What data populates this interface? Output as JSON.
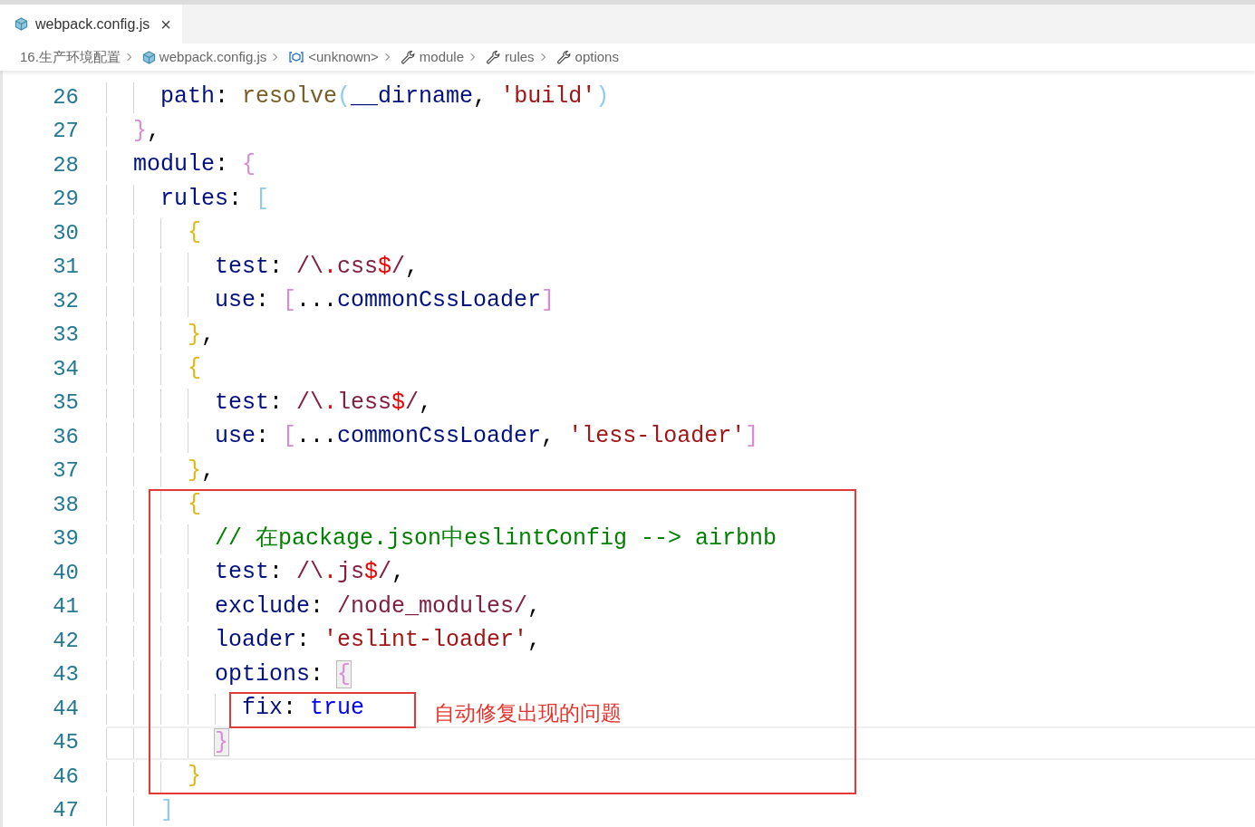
{
  "tab": {
    "label": "webpack.config.js",
    "close": "×",
    "selected": true
  },
  "breadcrumbs": [
    {
      "label": "16.生产环境配置",
      "kind": "folder"
    },
    {
      "label": "webpack.config.js",
      "kind": "file"
    },
    {
      "label": "<unknown>",
      "kind": "variable"
    },
    {
      "label": "module",
      "kind": "property"
    },
    {
      "label": "rules",
      "kind": "property"
    },
    {
      "label": "options",
      "kind": "property"
    }
  ],
  "lines": [
    {
      "children": [
        {
          "number": "26",
          "current": false,
          "tokens": [
            {
              "kind": "key",
              "text": "path"
            },
            {
              "kind": "punct",
              "text": ": "
            },
            {
              "kind": "func",
              "text": "resolve"
            },
            {
              "kind": "bracket",
              "text": "(",
              "color": "#8fcbef",
              "matched": false
            },
            {
              "kind": "key",
              "text": "__dirname"
            },
            {
              "kind": "punct",
              "text": ", "
            },
            {
              "kind": "string",
              "text": "'build'"
            },
            {
              "kind": "bracket",
              "text": ")",
              "color": "#8fcbef",
              "matched": false
            }
          ]
        }
      ]
    },
    {
      "number": "27",
      "current": false,
      "tokens": [
        {
          "kind": "bracket",
          "text": "}",
          "color": "#d88bd6",
          "matched": false
        },
        {
          "kind": "punct",
          "text": ","
        }
      ]
    },
    {
      "number": "28",
      "current": false,
      "tokens": [
        {
          "kind": "key",
          "text": "module"
        },
        {
          "kind": "punct",
          "text": ": "
        },
        {
          "kind": "bracket",
          "text": "{",
          "color": "#d88bd6",
          "matched": false
        }
      ],
      "children": [
        {
          "number": "29",
          "current": false,
          "tokens": [
            {
              "kind": "key",
              "text": "rules"
            },
            {
              "kind": "punct",
              "text": ": "
            },
            {
              "kind": "bracket",
              "text": "[",
              "color": "#8fcbef",
              "matched": false
            }
          ],
          "children": [
            {
              "number": "30",
              "current": false,
              "tokens": [
                {
                  "kind": "bracket",
                  "text": "{",
                  "color": "#e2b714",
                  "matched": false
                }
              ],
              "children": [
                {
                  "number": "31",
                  "current": false,
                  "tokens": [
                    {
                      "kind": "key",
                      "text": "test"
                    },
                    {
                      "kind": "punct",
                      "text": ": "
                    },
                    {
                      "kind": "regex",
                      "text": "/\\"
                    },
                    {
                      "kind": "regexop",
                      "text": "."
                    },
                    {
                      "kind": "regex",
                      "text": "css"
                    },
                    {
                      "kind": "regexop",
                      "text": "$"
                    },
                    {
                      "kind": "regex",
                      "text": "/"
                    },
                    {
                      "kind": "punct",
                      "text": ","
                    }
                  ]
                },
                {
                  "number": "32",
                  "current": false,
                  "tokens": [
                    {
                      "kind": "key",
                      "text": "use"
                    },
                    {
                      "kind": "punct",
                      "text": ": "
                    },
                    {
                      "kind": "bracket",
                      "text": "[",
                      "color": "#d88bd6",
                      "matched": false
                    },
                    {
                      "kind": "punct",
                      "text": "..."
                    },
                    {
                      "kind": "key",
                      "text": "commonCssLoader"
                    },
                    {
                      "kind": "bracket",
                      "text": "]",
                      "color": "#d88bd6",
                      "matched": false
                    }
                  ]
                }
              ]
            },
            {
              "number": "33",
              "current": false,
              "tokens": [
                {
                  "kind": "bracket",
                  "text": "}",
                  "color": "#e2b714",
                  "matched": false
                },
                {
                  "kind": "punct",
                  "text": ","
                }
              ]
            },
            {
              "number": "34",
              "current": false,
              "tokens": [
                {
                  "kind": "bracket",
                  "text": "{",
                  "color": "#e2b714",
                  "matched": false
                }
              ],
              "children": [
                {
                  "number": "35",
                  "current": false,
                  "tokens": [
                    {
                      "kind": "key",
                      "text": "test"
                    },
                    {
                      "kind": "punct",
                      "text": ": "
                    },
                    {
                      "kind": "regex",
                      "text": "/\\"
                    },
                    {
                      "kind": "regexop",
                      "text": "."
                    },
                    {
                      "kind": "regex",
                      "text": "less"
                    },
                    {
                      "kind": "regexop",
                      "text": "$"
                    },
                    {
                      "kind": "regex",
                      "text": "/"
                    },
                    {
                      "kind": "punct",
                      "text": ","
                    }
                  ]
                },
                {
                  "number": "36",
                  "current": false,
                  "tokens": [
                    {
                      "kind": "key",
                      "text": "use"
                    },
                    {
                      "kind": "punct",
                      "text": ": "
                    },
                    {
                      "kind": "bracket",
                      "text": "[",
                      "color": "#d88bd6",
                      "matched": false
                    },
                    {
                      "kind": "punct",
                      "text": "..."
                    },
                    {
                      "kind": "key",
                      "text": "commonCssLoader"
                    },
                    {
                      "kind": "punct",
                      "text": ", "
                    },
                    {
                      "kind": "string",
                      "text": "'less-loader'"
                    },
                    {
                      "kind": "bracket",
                      "text": "]",
                      "color": "#d88bd6",
                      "matched": false
                    }
                  ]
                }
              ]
            },
            {
              "number": "37",
              "current": false,
              "tokens": [
                {
                  "kind": "bracket",
                  "text": "}",
                  "color": "#e2b714",
                  "matched": false
                },
                {
                  "kind": "punct",
                  "text": ","
                }
              ]
            },
            {
              "number": "38",
              "current": false,
              "tokens": [
                {
                  "kind": "bracket",
                  "text": "{",
                  "color": "#e2b714",
                  "matched": false
                }
              ],
              "children": [
                {
                  "number": "39",
                  "current": false,
                  "tokens": [
                    {
                      "kind": "comment",
                      "text": "// 在package.json中eslintConfig --> airbnb"
                    }
                  ]
                },
                {
                  "number": "40",
                  "current": false,
                  "tokens": [
                    {
                      "kind": "key",
                      "text": "test"
                    },
                    {
                      "kind": "punct",
                      "text": ": "
                    },
                    {
                      "kind": "regex",
                      "text": "/\\"
                    },
                    {
                      "kind": "regexop",
                      "text": "."
                    },
                    {
                      "kind": "regex",
                      "text": "js"
                    },
                    {
                      "kind": "regexop",
                      "text": "$"
                    },
                    {
                      "kind": "regex",
                      "text": "/"
                    },
                    {
                      "kind": "punct",
                      "text": ","
                    }
                  ]
                },
                {
                  "number": "41",
                  "current": false,
                  "tokens": [
                    {
                      "kind": "key",
                      "text": "exclude"
                    },
                    {
                      "kind": "punct",
                      "text": ": "
                    },
                    {
                      "kind": "regex",
                      "text": "/node_modules/"
                    },
                    {
                      "kind": "punct",
                      "text": ","
                    }
                  ]
                },
                {
                  "number": "42",
                  "current": false,
                  "tokens": [
                    {
                      "kind": "key",
                      "text": "loader"
                    },
                    {
                      "kind": "punct",
                      "text": ": "
                    },
                    {
                      "kind": "string",
                      "text": "'eslint-loader'"
                    },
                    {
                      "kind": "punct",
                      "text": ","
                    }
                  ]
                },
                {
                  "number": "43",
                  "current": false,
                  "tokens": [
                    {
                      "kind": "key",
                      "text": "options"
                    },
                    {
                      "kind": "punct",
                      "text": ": "
                    },
                    {
                      "kind": "bracket",
                      "text": "{",
                      "color": "#d88bd6",
                      "matched": true
                    }
                  ],
                  "children": [
                    {
                      "number": "44",
                      "current": false,
                      "tokens": [
                        {
                          "kind": "key",
                          "text": "fix"
                        },
                        {
                          "kind": "punct",
                          "text": ": "
                        },
                        {
                          "kind": "keyword",
                          "text": "true"
                        }
                      ]
                    }
                  ]
                },
                {
                  "number": "45",
                  "current": true,
                  "tokens": [
                    {
                      "kind": "bracket",
                      "text": "}",
                      "color": "#d88bd6",
                      "matched": true
                    }
                  ]
                }
              ]
            },
            {
              "number": "46",
              "current": false,
              "tokens": [
                {
                  "kind": "bracket",
                  "text": "}",
                  "color": "#e2b714",
                  "matched": false
                }
              ]
            }
          ]
        },
        {
          "number": "47",
          "current": false,
          "tokens": [
            {
              "kind": "bracket",
              "text": "]",
              "color": "#8fcbef",
              "matched": false
            }
          ]
        }
      ]
    }
  ],
  "annotation": {
    "text": "自动修复出现的问题"
  }
}
